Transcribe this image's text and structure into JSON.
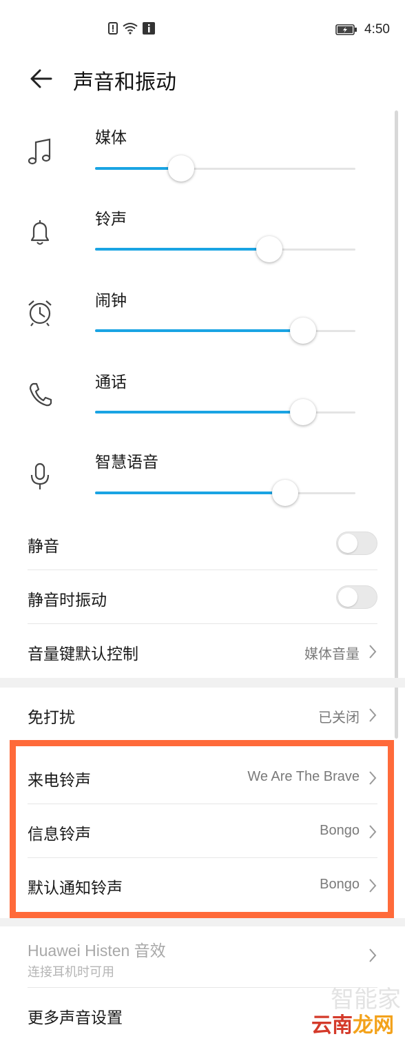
{
  "status_bar": {
    "time": "4:50"
  },
  "header": {
    "title": "声音和振动"
  },
  "volumes": [
    {
      "label": "媒体",
      "icon": "music-note-icon",
      "level": 0.33
    },
    {
      "label": "铃声",
      "icon": "bell-icon",
      "level": 0.67
    },
    {
      "label": "闹钟",
      "icon": "alarm-clock-icon",
      "level": 0.8
    },
    {
      "label": "通话",
      "icon": "phone-icon",
      "level": 0.8
    },
    {
      "label": "智慧语音",
      "icon": "microphone-icon",
      "level": 0.73
    }
  ],
  "settings": {
    "mute": {
      "label": "静音",
      "on": false
    },
    "vibrate_on_mute": {
      "label": "静音时振动",
      "on": false
    },
    "volume_key": {
      "label": "音量键默认控制",
      "value": "媒体音量"
    },
    "dnd": {
      "label": "免打扰",
      "value": "已关闭"
    },
    "ringtone": {
      "label": "来电铃声",
      "value": "We Are The Brave"
    },
    "message_tone": {
      "label": "信息铃声",
      "value": "Bongo"
    },
    "notification_tone": {
      "label": "默认通知铃声",
      "value": "Bongo"
    },
    "histen": {
      "label": "Huawei Histen 音效",
      "sub": "连接耳机时可用"
    },
    "more": {
      "label": "更多声音设置"
    }
  },
  "watermark": {
    "line1": "智能家",
    "line2_a": "云南",
    "line2_b": "龙网"
  },
  "colors": {
    "accent": "#1aa4e3",
    "highlight": "#ff6a3a"
  }
}
